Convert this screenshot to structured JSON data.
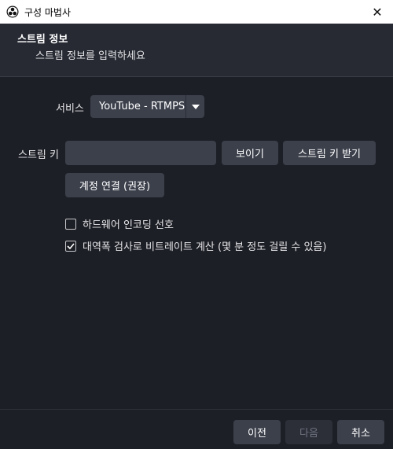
{
  "window": {
    "title": "구성 마법사",
    "close_glyph": "✕"
  },
  "header": {
    "title": "스트림 정보",
    "subtitle": "스트림 정보를 입력하세요"
  },
  "form": {
    "service_label": "서비스",
    "service_value": "YouTube - RTMPS",
    "stream_key_label": "스트림 키",
    "stream_key_value": "",
    "show_button": "보이기",
    "get_key_button": "스트림 키 받기",
    "connect_account_button": "계정 연결 (권장)",
    "hw_encoding_label": "하드웨어 인코딩 선호",
    "hw_encoding_checked": false,
    "bandwidth_test_label": "대역폭 검사로 비트레이트 계산 (몇 분 정도 걸릴 수 있음)",
    "bandwidth_test_checked": true
  },
  "footer": {
    "back_button": "이전",
    "next_button": "다음",
    "cancel_button": "취소"
  },
  "colors": {
    "background": "#1d1f26",
    "header_bg": "#272a33",
    "control_bg": "#3c404b",
    "titlebar_bg": "#ffffff"
  }
}
